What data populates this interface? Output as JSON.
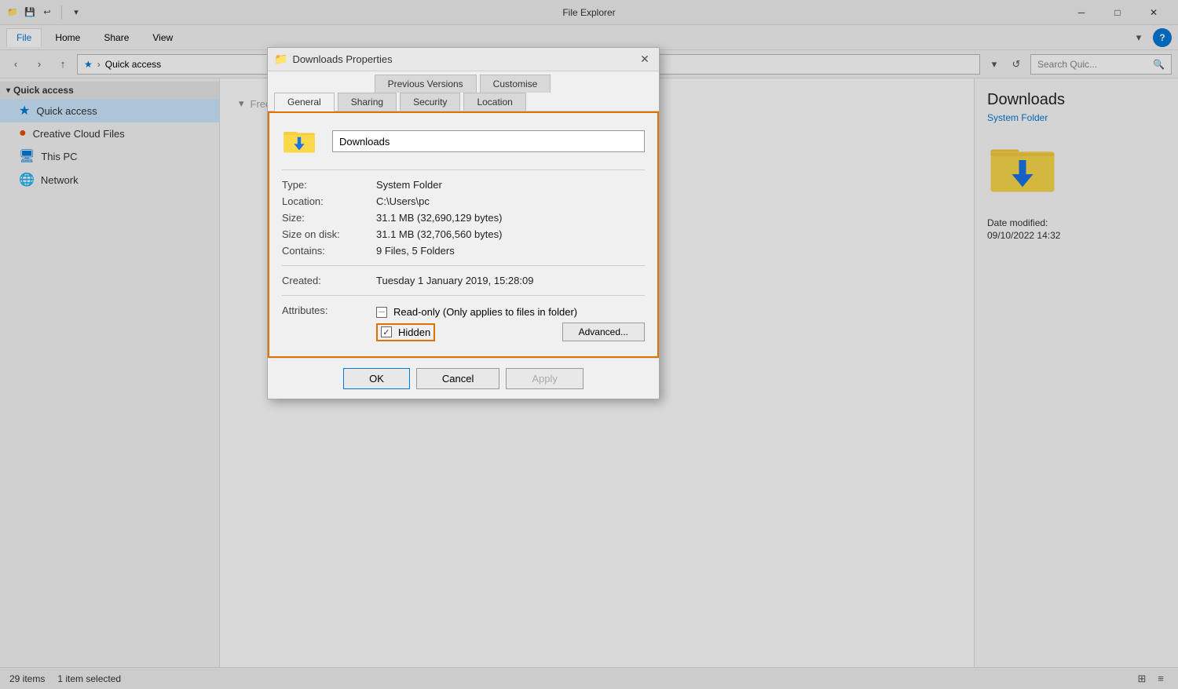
{
  "titleBar": {
    "title": "File Explorer",
    "minimizeLabel": "─",
    "maximizeLabel": "□",
    "closeLabel": "✕"
  },
  "ribbon": {
    "tabs": [
      "File",
      "Home",
      "Share",
      "View"
    ],
    "activeTab": "File"
  },
  "addressBar": {
    "path": "Quick access",
    "pathStar": "★",
    "pathArrow": "›",
    "searchPlaceholder": "Search Quic...",
    "searchIcon": "🔍",
    "refreshIcon": "↺",
    "dropdownIcon": "▾"
  },
  "sidebar": {
    "sections": [
      {
        "name": "Quick access",
        "expanded": true,
        "items": [
          {
            "label": "Quick access",
            "icon": "★",
            "selected": true
          }
        ]
      }
    ],
    "items": [
      {
        "label": "Creative Cloud Files",
        "icon": "☁",
        "color": "#e84d00"
      },
      {
        "label": "This PC",
        "icon": "💻",
        "color": "#0078d7"
      },
      {
        "label": "Network",
        "icon": "🌐",
        "color": "#4a90d9"
      }
    ]
  },
  "rightPanel": {
    "title": "Downloads",
    "subtitle": "System Folder",
    "dateLabel": "Date modified:",
    "dateValue": "09/10/2022 14:32"
  },
  "statusBar": {
    "itemCount": "29 items",
    "selectedCount": "1 item selected"
  },
  "dialog": {
    "title": "Downloads Properties",
    "titleIcon": "📁",
    "tabs": {
      "row1": [
        "Previous Versions",
        "Customise"
      ],
      "row2": [
        "General",
        "Sharing",
        "Security",
        "Location"
      ],
      "activeTab": "General"
    },
    "folderName": "Downloads",
    "fields": [
      {
        "label": "Type:",
        "value": "System Folder"
      },
      {
        "label": "Location:",
        "value": "C:\\Users\\pc"
      },
      {
        "label": "Size:",
        "value": "31.1 MB (32,690,129 bytes)"
      },
      {
        "label": "Size on disk:",
        "value": "31.1 MB (32,706,560 bytes)"
      },
      {
        "label": "Contains:",
        "value": "9 Files, 5 Folders"
      }
    ],
    "created": {
      "label": "Created:",
      "value": "Tuesday 1 January 2019, 15:28:09"
    },
    "attributes": {
      "label": "Attributes:",
      "readOnly": "Read-only (Only applies to files in folder)",
      "hidden": "Hidden",
      "advancedBtn": "Advanced..."
    },
    "footer": {
      "ok": "OK",
      "cancel": "Cancel",
      "apply": "Apply"
    }
  }
}
